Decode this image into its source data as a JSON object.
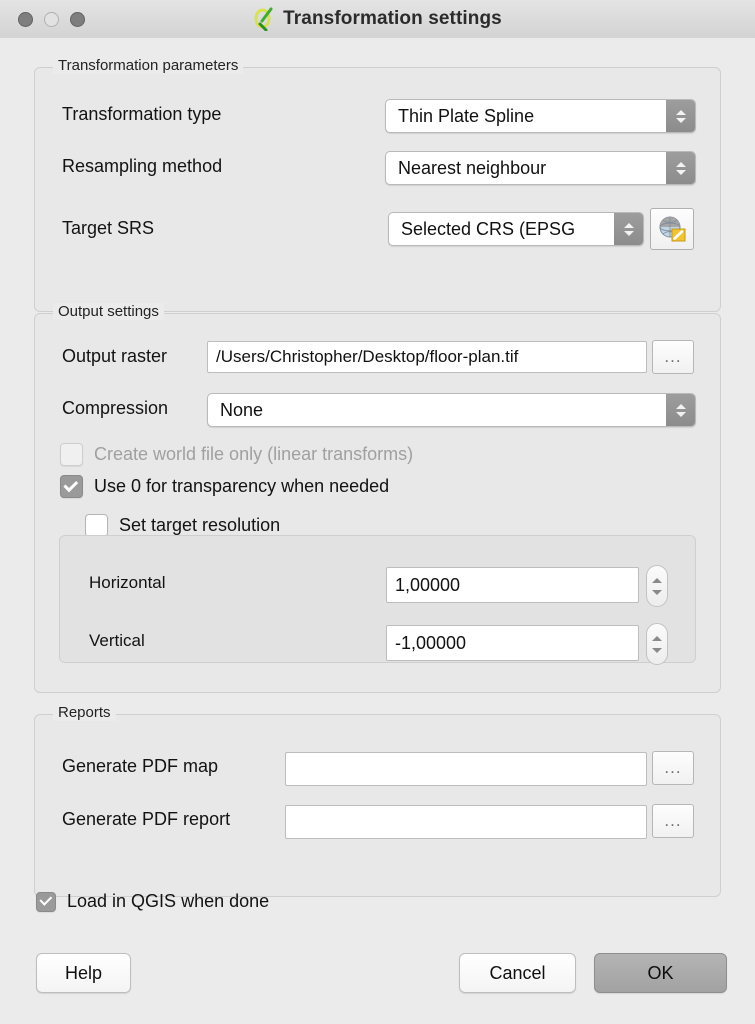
{
  "window": {
    "title": "Transformation settings",
    "app_icon": "qgis-logo-icon",
    "controls": {
      "close": "close-button",
      "minimize": "minimize-button",
      "zoom": "zoom-button"
    }
  },
  "transformation_parameters": {
    "legend": "Transformation parameters",
    "transformation_type": {
      "label": "Transformation type",
      "value": "Thin Plate Spline"
    },
    "resampling_method": {
      "label": "Resampling method",
      "value": "Nearest neighbour"
    },
    "target_srs": {
      "label": "Target SRS",
      "value": "Selected CRS (EPSG",
      "select_button_icon": "globe-edit-icon"
    }
  },
  "output_settings": {
    "legend": "Output settings",
    "output_raster": {
      "label": "Output raster",
      "value": "/Users/Christopher/Desktop/floor-plan.tif",
      "browse_label": "..."
    },
    "compression": {
      "label": "Compression",
      "value": "None"
    },
    "create_world_file": {
      "label": "Create world file only (linear transforms)",
      "checked": false,
      "disabled": true
    },
    "use_zero_transparency": {
      "label": "Use 0 for transparency when needed",
      "checked": true,
      "disabled": false
    },
    "set_target_resolution": {
      "label": "Set target resolution",
      "checked": false,
      "disabled": false
    },
    "horizontal": {
      "label": "Horizontal",
      "value": "1,00000"
    },
    "vertical": {
      "label": "Vertical",
      "value": "-1,00000"
    }
  },
  "reports": {
    "legend": "Reports",
    "pdf_map": {
      "label": "Generate PDF map",
      "value": "",
      "browse_label": "..."
    },
    "pdf_report": {
      "label": "Generate PDF report",
      "value": "",
      "browse_label": "..."
    }
  },
  "footer": {
    "load_in_qgis": {
      "label": "Load in QGIS when done",
      "checked": true
    },
    "help_label": "Help",
    "cancel_label": "Cancel",
    "ok_label": "OK"
  }
}
